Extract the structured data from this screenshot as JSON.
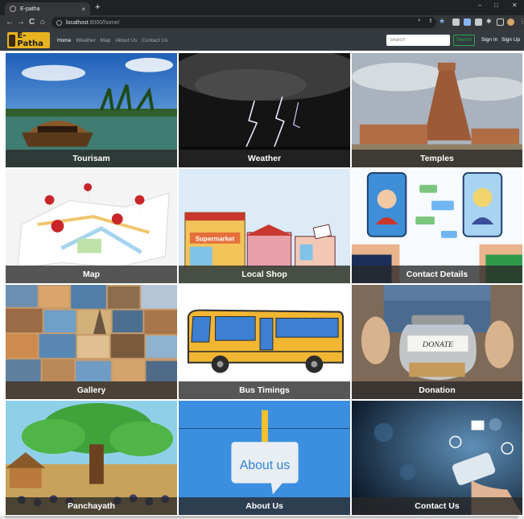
{
  "browser": {
    "tab_title": "E-patha",
    "tab_close": "×",
    "new_tab": "+",
    "url_host": "localhost",
    "url_rest": ":8000/home/",
    "nav_back": "←",
    "nav_forward": "→",
    "nav_reload": "C",
    "nav_home": "⌂",
    "min": "–",
    "max": "□",
    "close": "✕"
  },
  "navbar": {
    "brand": "E-Patha",
    "links": [
      "Home",
      "Weather",
      "Map",
      "About Us",
      "Contact Us"
    ],
    "search_placeholder": "Search",
    "search_button": "Search",
    "sign_in": "Sign In",
    "sign_up": "Sign Up"
  },
  "tiles": [
    {
      "label": "Tourisam"
    },
    {
      "label": "Weather"
    },
    {
      "label": "Temples"
    },
    {
      "label": "Map"
    },
    {
      "label": "Local Shop"
    },
    {
      "label": "Contact Details"
    },
    {
      "label": "Gallery"
    },
    {
      "label": "Bus Timings"
    },
    {
      "label": "Donation"
    },
    {
      "label": "Panchayath"
    },
    {
      "label": "About Us"
    },
    {
      "label": "Contact Us"
    }
  ],
  "artwork": {
    "shop_sign": "Supermarket",
    "about_board": "About us",
    "donate_label": "DONATE"
  },
  "colors": {
    "navbar_bg": "#343a40",
    "brand_bg": "#e8b321",
    "search_button": "#28a745",
    "caption_bg": "#282828"
  }
}
